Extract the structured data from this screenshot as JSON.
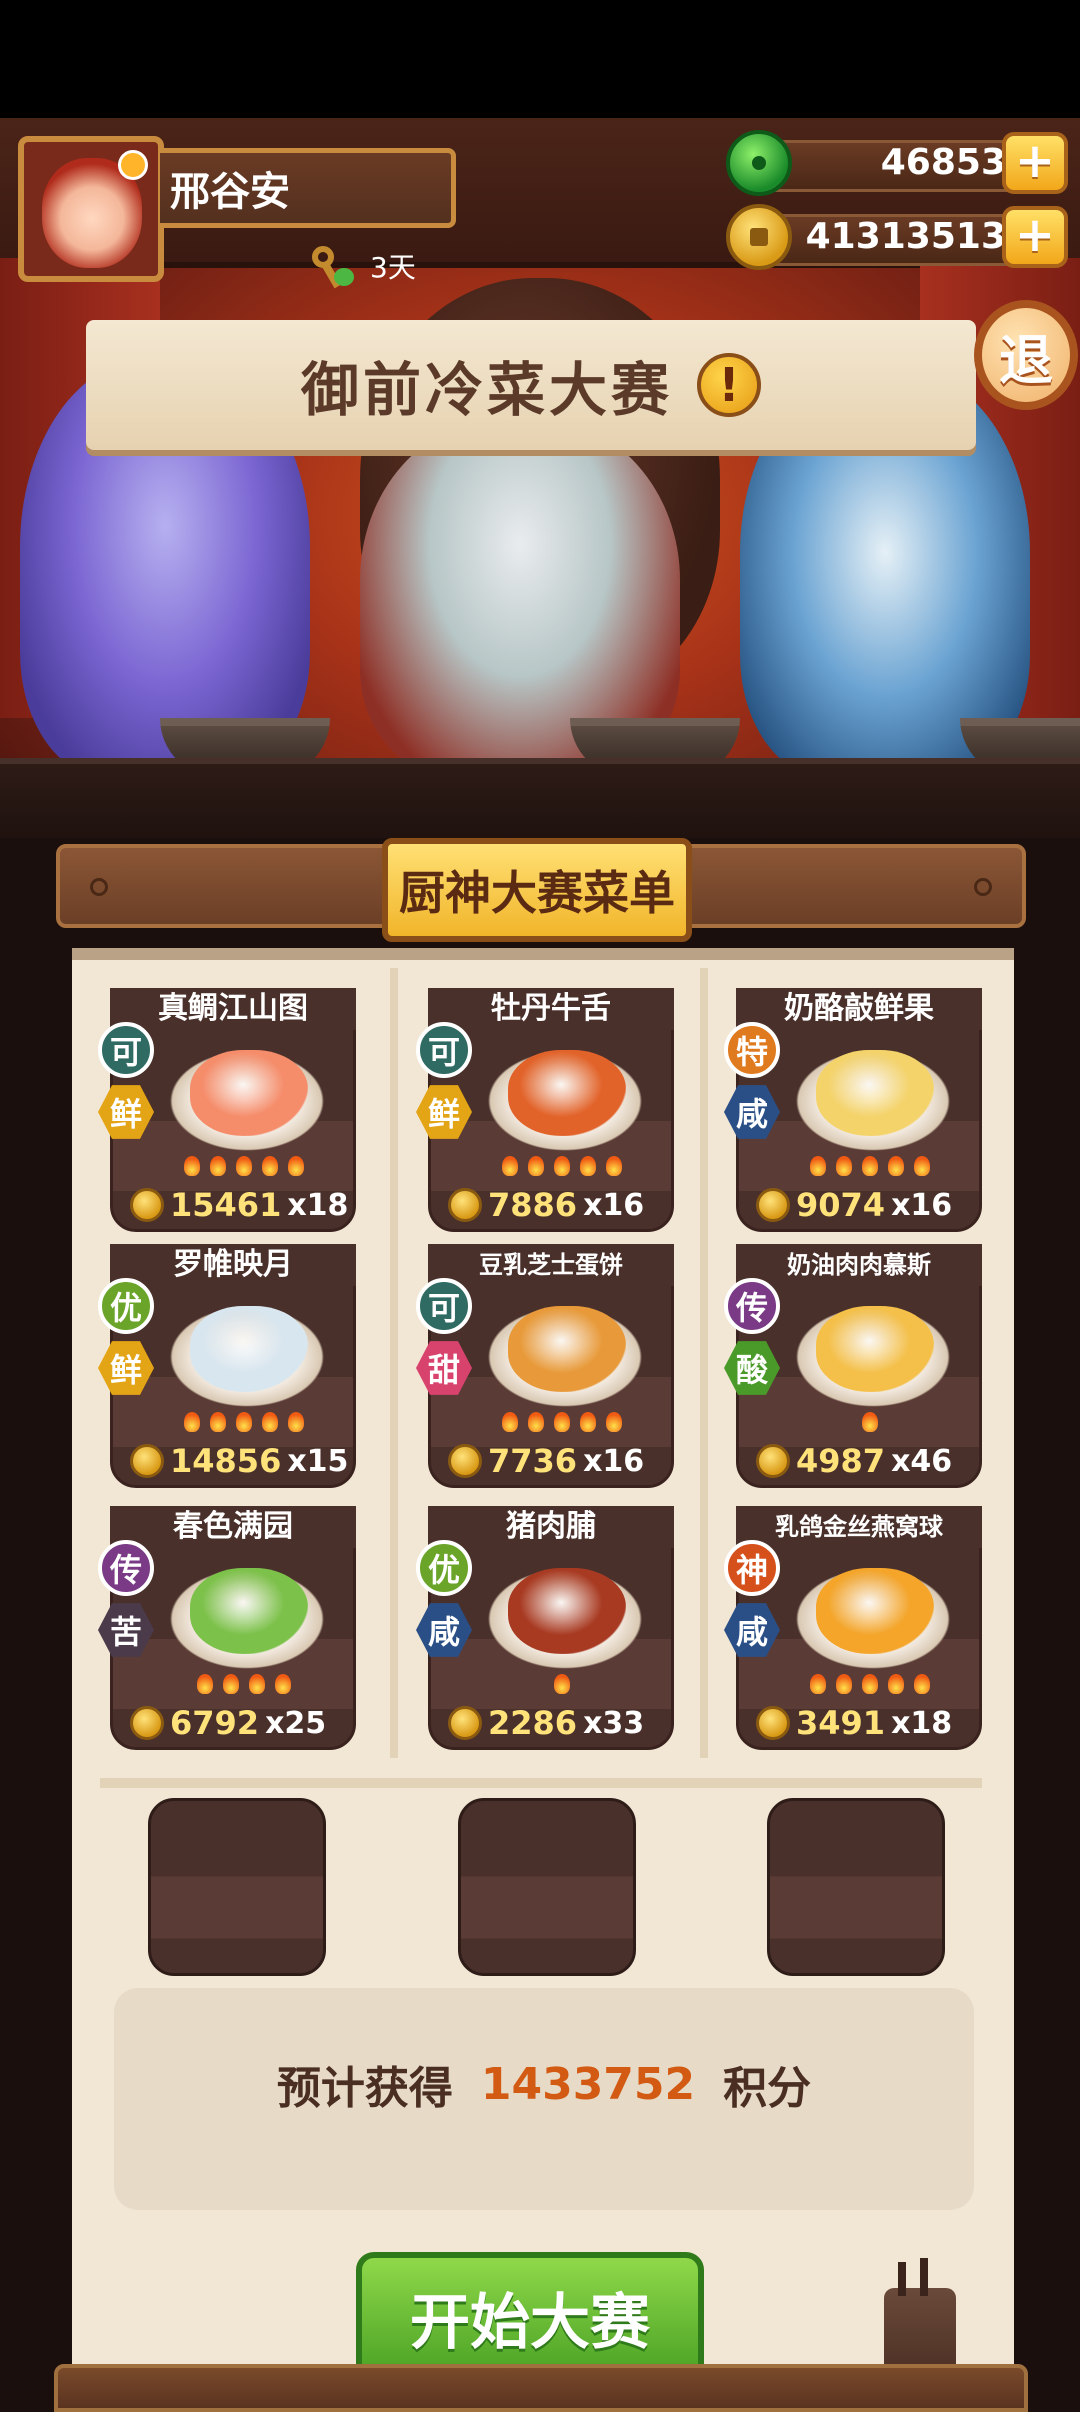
{
  "player": {
    "name": "邢谷安",
    "days": "3天"
  },
  "currency": {
    "jade": "46853",
    "gold": "41313513"
  },
  "banner": {
    "title": "御前冷菜大赛",
    "alert": "!"
  },
  "exit_label": "退",
  "menu_title": "厨神大赛菜单",
  "dishes": [
    {
      "name": "真鲷江山图",
      "rank": "可",
      "rank_color": "#2f6b63",
      "taste": "鲜",
      "taste_color": "#e3a516",
      "food_color": "#f58c6a",
      "price": "15461",
      "qty": "x18",
      "flames": 5
    },
    {
      "name": "牡丹牛舌",
      "rank": "可",
      "rank_color": "#2f6b63",
      "taste": "鲜",
      "taste_color": "#e3a516",
      "food_color": "#e2632a",
      "price": "7886",
      "qty": "x16",
      "flames": 5
    },
    {
      "name": "奶酪敲鲜果",
      "rank": "特",
      "rank_color": "#e07a1e",
      "taste": "咸",
      "taste_color": "#2a4f86",
      "food_color": "#f4d36a",
      "price": "9074",
      "qty": "x16",
      "flames": 5
    },
    {
      "name": "罗帷映月",
      "rank": "优",
      "rank_color": "#6aa52a",
      "taste": "鲜",
      "taste_color": "#e3a516",
      "food_color": "#d8e6ef",
      "price": "14856",
      "qty": "x15",
      "flames": 5
    },
    {
      "name": "豆乳芝士蛋饼",
      "rank": "可",
      "rank_color": "#2f6b63",
      "taste": "甜",
      "taste_color": "#d8436e",
      "food_color": "#e89a3a",
      "price": "7736",
      "qty": "x16",
      "flames": 5,
      "small": true
    },
    {
      "name": "奶油肉肉慕斯",
      "rank": "传",
      "rank_color": "#7a3a86",
      "taste": "酸",
      "taste_color": "#4a9a2a",
      "food_color": "#f4c04a",
      "price": "4987",
      "qty": "x46",
      "flames": 1,
      "small": true
    },
    {
      "name": "春色满园",
      "rank": "传",
      "rank_color": "#7a3a86",
      "taste": "苦",
      "taste_color": "#4a3a4a",
      "food_color": "#7cc14a",
      "price": "6792",
      "qty": "x25",
      "flames": 4
    },
    {
      "name": "猪肉脯",
      "rank": "优",
      "rank_color": "#6aa52a",
      "taste": "咸",
      "taste_color": "#2a4f86",
      "food_color": "#a83a22",
      "price": "2286",
      "qty": "x33",
      "flames": 1
    },
    {
      "name": "乳鸽金丝燕窝球",
      "rank": "神",
      "rank_color": "#d5501a",
      "taste": "咸",
      "taste_color": "#2a4f86",
      "food_color": "#f4a52a",
      "price": "3491",
      "qty": "x18",
      "flames": 5,
      "small": true
    }
  ],
  "estimate": {
    "label": "预计获得",
    "value": "1433752",
    "unit": "积分"
  },
  "start_button": "开始大赛"
}
